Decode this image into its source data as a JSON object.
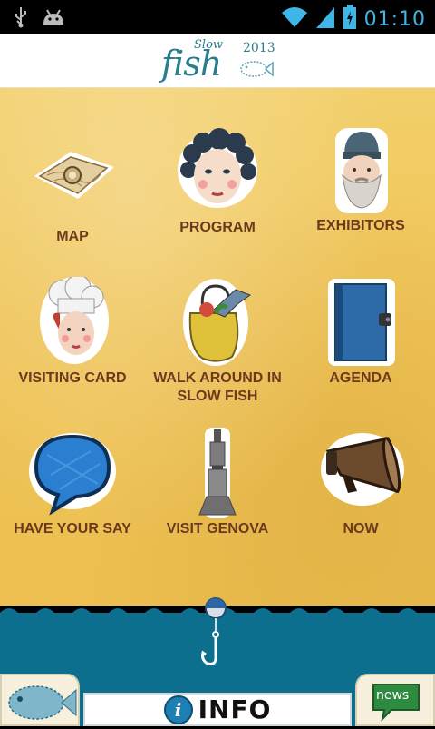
{
  "status_bar": {
    "time": "01:10",
    "icons": [
      "usb-icon",
      "android-debug-icon",
      "wifi-icon",
      "signal-icon",
      "battery-icon"
    ]
  },
  "header": {
    "logo_word": "fish",
    "logo_small": "Slow",
    "logo_year": "2013"
  },
  "menu": {
    "items": [
      {
        "label": "MAP",
        "icon": "map-icon"
      },
      {
        "label": "PROGRAM",
        "icon": "woman-face-icon"
      },
      {
        "label": "EXHIBITORS",
        "icon": "fisherman-icon"
      },
      {
        "label": "VISITING CARD",
        "icon": "chef-icon"
      },
      {
        "label": "WALK AROUND IN SLOW FISH",
        "icon": "shopping-bag-icon"
      },
      {
        "label": "AGENDA",
        "icon": "agenda-book-icon"
      },
      {
        "label": "HAVE YOUR SAY",
        "icon": "speech-bubble-icon"
      },
      {
        "label": "VISIT GENOVA",
        "icon": "lighthouse-icon"
      },
      {
        "label": "NOW",
        "icon": "megaphone-icon"
      }
    ]
  },
  "bottom": {
    "info_label": "INFO",
    "info_icon_letter": "i",
    "news_label": "news"
  },
  "colors": {
    "label": "#6b3a1e",
    "sea": "#0c6f8d",
    "paper": "#efc457",
    "clock": "#3fb6e8"
  }
}
